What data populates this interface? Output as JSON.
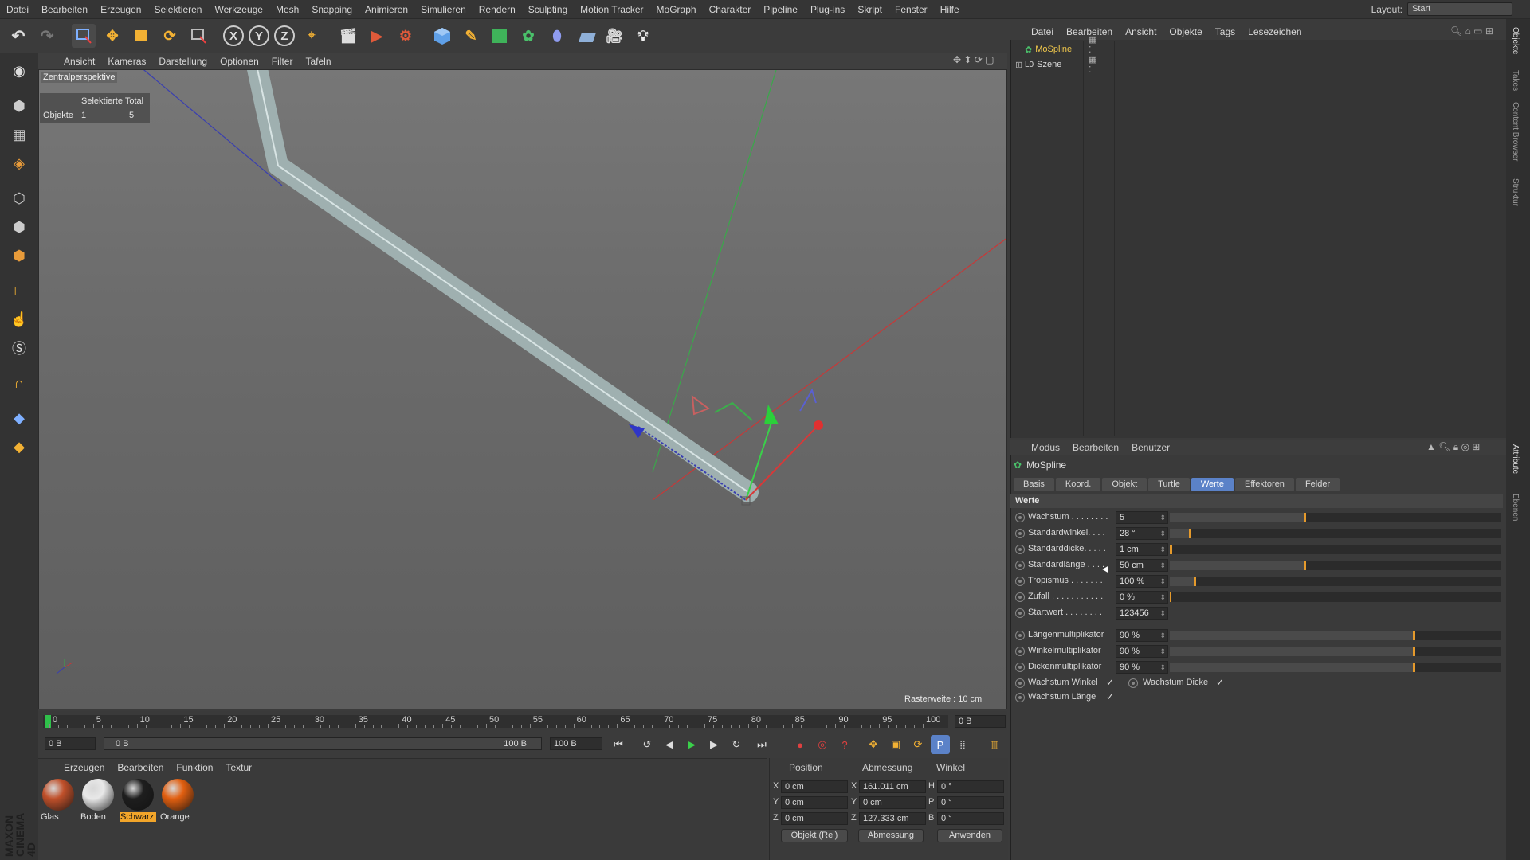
{
  "menubar": {
    "items": [
      "Datei",
      "Bearbeiten",
      "Erzeugen",
      "Selektieren",
      "Werkzeuge",
      "Mesh",
      "Snapping",
      "Animieren",
      "Simulieren",
      "Rendern",
      "Sculpting",
      "Motion Tracker",
      "MoGraph",
      "Charakter",
      "Pipeline",
      "Plug-ins",
      "Skript",
      "Fenster",
      "Hilfe"
    ],
    "layout_label": "Layout:",
    "layout_value": "Start"
  },
  "toolbar": {
    "axis_labels": [
      "X",
      "Y",
      "Z"
    ]
  },
  "viewport": {
    "menu": [
      "Ansicht",
      "Kameras",
      "Darstellung",
      "Optionen",
      "Filter",
      "Tafeln"
    ],
    "perspective_label": "Zentralperspektive",
    "hud": {
      "header": "Selektierte Total",
      "row_label": "Objekte",
      "selected": "1",
      "total": "5"
    },
    "raster_label": "Rasterweite : 10 cm"
  },
  "timeline": {
    "ticks": [
      "0",
      "5",
      "10",
      "15",
      "20",
      "25",
      "30",
      "35",
      "40",
      "45",
      "50",
      "55",
      "60",
      "65",
      "70",
      "75",
      "80",
      "85",
      "90",
      "95",
      "100"
    ],
    "current_frame": "0 B",
    "start_field": "0 B",
    "range_start": "0 B",
    "range_end": "100 B",
    "end_field": "100 B"
  },
  "materials": {
    "menu": [
      "Erzeugen",
      "Bearbeiten",
      "Funktion",
      "Textur"
    ],
    "items": [
      {
        "name": "Glas",
        "color": "#c0502a"
      },
      {
        "name": "Boden",
        "color": "#e8e8e8"
      },
      {
        "name": "Schwarz",
        "color": "#1e1e1e"
      },
      {
        "name": "Orange",
        "color": "#e25f10"
      }
    ]
  },
  "coords": {
    "headers": [
      "Position",
      "Abmessung",
      "Winkel"
    ],
    "rows": [
      {
        "axis": "X",
        "pos": "0 cm",
        "size_axis": "X",
        "size": "161.011 cm",
        "rot_axis": "H",
        "rot": "0 °"
      },
      {
        "axis": "Y",
        "pos": "0 cm",
        "size_axis": "Y",
        "size": "0 cm",
        "rot_axis": "P",
        "rot": "0 °"
      },
      {
        "axis": "Z",
        "pos": "0 cm",
        "size_axis": "Z",
        "size": "127.333 cm",
        "rot_axis": "B",
        "rot": "0 °"
      }
    ],
    "mode_button": "Objekt (Rel)",
    "size_button": "Abmessung",
    "apply_button": "Anwenden"
  },
  "object_manager": {
    "menu": [
      "Datei",
      "Bearbeiten",
      "Ansicht",
      "Objekte",
      "Tags",
      "Lesezeichen"
    ],
    "objects": [
      {
        "name": "MoSpline",
        "selected": true
      },
      {
        "name": "Szene",
        "selected": false
      }
    ]
  },
  "side_tabs": [
    "Objekte",
    "Takes",
    "Content Browser",
    "Struktur",
    "Attribute",
    "Ebenen"
  ],
  "attributes": {
    "menu": [
      "Modus",
      "Bearbeiten",
      "Benutzer"
    ],
    "object_name": "MoSpline",
    "tabs": [
      "Basis",
      "Koord.",
      "Objekt",
      "Turtle",
      "Werte",
      "Effektoren",
      "Felder"
    ],
    "active_tab": "Werte",
    "section": "Werte",
    "params": [
      {
        "label": "Wachstum . . . . . . . .",
        "value": "5",
        "fill": 0.41
      },
      {
        "label": "Standardwinkel. . . .",
        "value": "28 °",
        "fill": 0.065
      },
      {
        "label": "Standarddicke. . . . .",
        "value": "1 cm",
        "fill": 0.005
      },
      {
        "label": "Standardlänge . . . .",
        "value": "50 cm",
        "fill": 0.41
      },
      {
        "label": "Tropismus . . . . . . .",
        "value": "100 %",
        "fill": 0.08
      },
      {
        "label": "Zufall . . . . . . . . . . .",
        "value": "0 %",
        "fill": 0.0
      },
      {
        "label": "Startwert . . . . . . . .",
        "value": "123456",
        "fill": null
      }
    ],
    "multipliers": [
      {
        "label": "Längenmultiplikator",
        "value": "90 %",
        "fill": 0.74
      },
      {
        "label": "Winkelmultiplikator",
        "value": "90 %",
        "fill": 0.74
      },
      {
        "label": "Dickenmultiplikator",
        "value": "90 %",
        "fill": 0.74
      }
    ],
    "checks": {
      "wachstum_winkel": "Wachstum Winkel",
      "wachstum_dicke": "Wachstum Dicke",
      "wachstum_laenge": "Wachstum Länge"
    }
  },
  "colors": {
    "accent": "#5b82c8",
    "slider_handle": "#e59a2c",
    "selected_text": "#f2c94c"
  }
}
